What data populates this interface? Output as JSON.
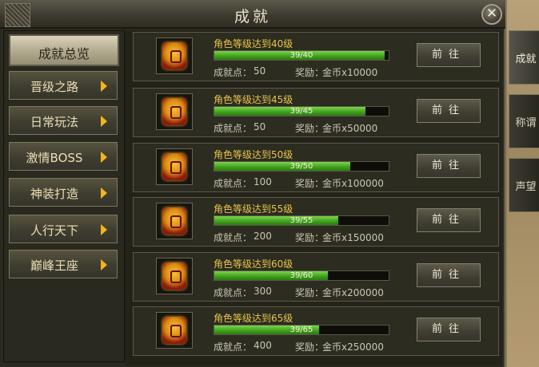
{
  "window": {
    "title": "成就",
    "close_glyph": "✕"
  },
  "sidebar": {
    "items": [
      {
        "label": "成就总览",
        "active": true
      },
      {
        "label": "晋级之路"
      },
      {
        "label": "日常玩法"
      },
      {
        "label": "激情BOSS"
      },
      {
        "label": "神装打造"
      },
      {
        "label": "人行天下"
      },
      {
        "label": "巅峰王座"
      }
    ]
  },
  "labels": {
    "points": "成就点：",
    "reward": "奖励：",
    "go_button": "前往"
  },
  "achievements": [
    {
      "title": "角色等级达到40级",
      "progress_text": "39/40",
      "progress": 0.975,
      "points": "50",
      "reward": "金币x10000"
    },
    {
      "title": "角色等级达到45级",
      "progress_text": "39/45",
      "progress": 0.867,
      "points": "50",
      "reward": "金币x50000"
    },
    {
      "title": "角色等级达到50级",
      "progress_text": "39/50",
      "progress": 0.78,
      "points": "100",
      "reward": "金币x100000"
    },
    {
      "title": "角色等级达到55级",
      "progress_text": "39/55",
      "progress": 0.709,
      "points": "200",
      "reward": "金币x150000"
    },
    {
      "title": "角色等级达到60级",
      "progress_text": "39/60",
      "progress": 0.65,
      "points": "300",
      "reward": "金币x200000"
    },
    {
      "title": "角色等级达到65级",
      "progress_text": "39/65",
      "progress": 0.6,
      "points": "400",
      "reward": "金币x250000"
    }
  ],
  "side_tabs": [
    {
      "label": "成就",
      "active": true
    },
    {
      "label": "称谓"
    },
    {
      "label": "声望"
    }
  ],
  "colors": {
    "progress_green": "#3e9e1c",
    "title_gold": "#e7c44a",
    "arrow": "#f2b51b"
  }
}
